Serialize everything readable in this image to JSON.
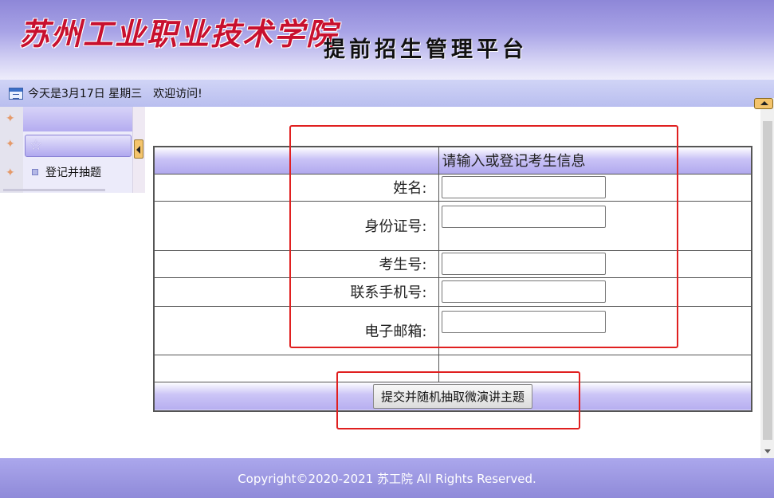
{
  "header": {
    "school_name": "苏州工业职业技术学院",
    "platform_name": "提前招生管理平台"
  },
  "statusbar": {
    "date_text": "今天是3月17日 星期三",
    "welcome": "欢迎访问!"
  },
  "sidebar": {
    "menu_item": "登记并抽题"
  },
  "form": {
    "header_title": "请输入或登记考生信息",
    "fields": [
      {
        "label": "姓名:",
        "value": ""
      },
      {
        "label": "身份证号:",
        "value": ""
      },
      {
        "label": "考生号:",
        "value": ""
      },
      {
        "label": "联系手机号:",
        "value": ""
      },
      {
        "label": "电子邮箱:",
        "value": ""
      }
    ],
    "submit_label": "提交并随机抽取微演讲主题"
  },
  "footer": {
    "copyright": "Copyright©2020-2021 苏工院 All Rights Reserved."
  },
  "colors": {
    "accent": "#a8a3e6",
    "annotation_red": "#e02020",
    "school_name_red": "#c8102e"
  }
}
